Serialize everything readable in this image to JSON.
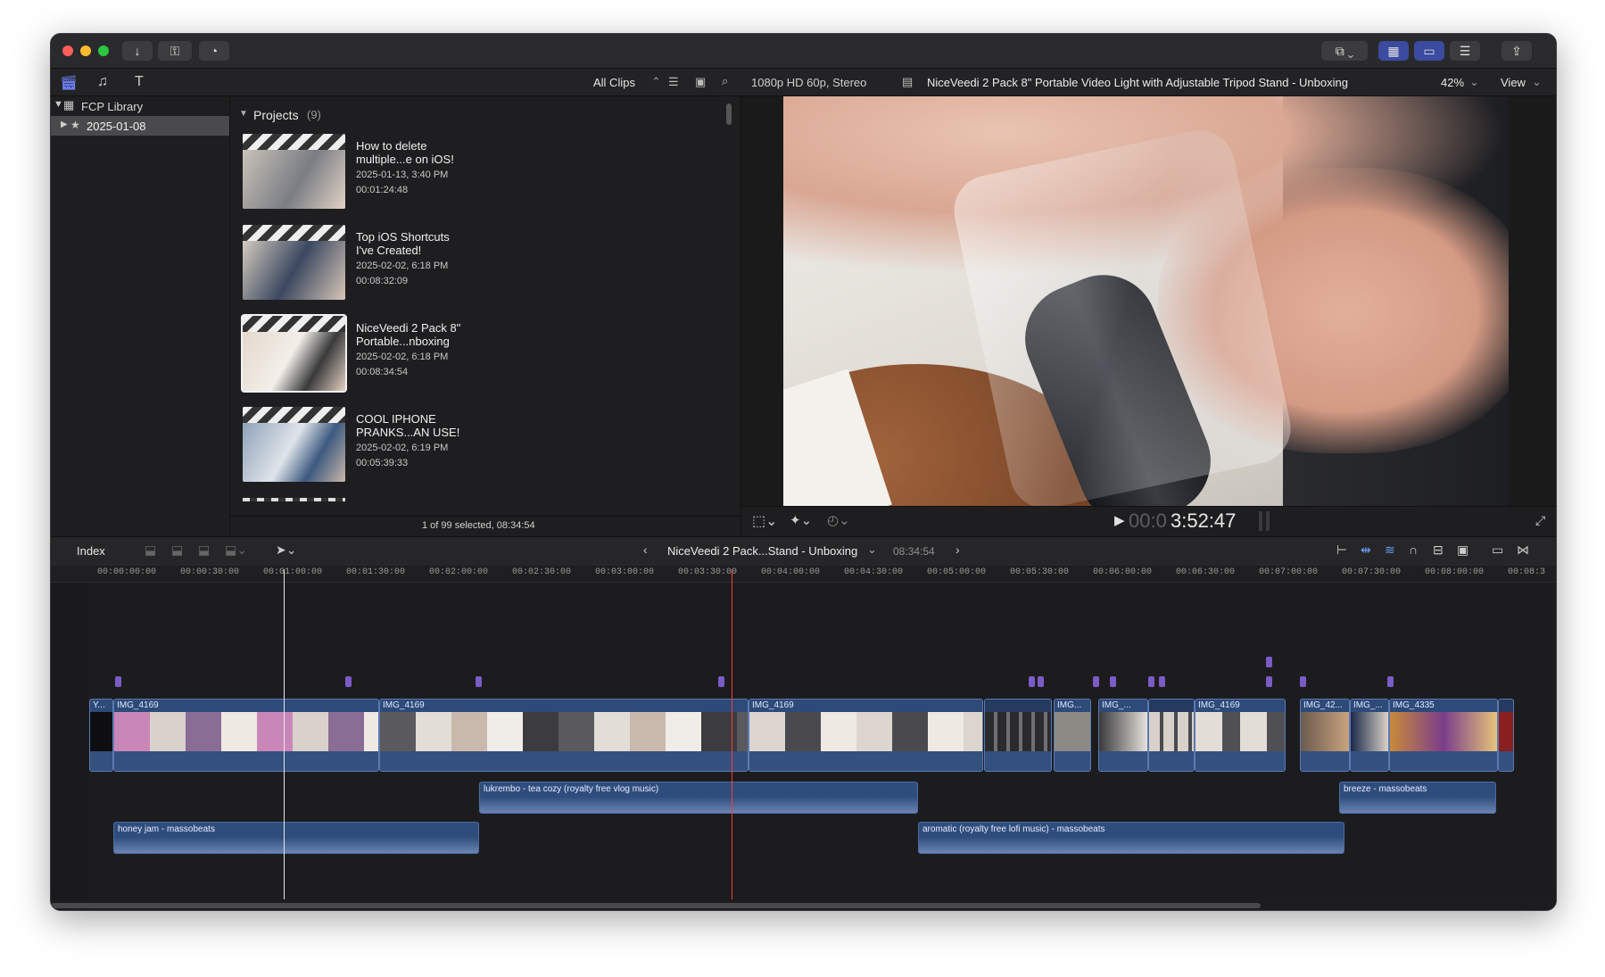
{
  "toolbar": {
    "import_icon": "download-icon",
    "keywords_icon": "key-icon",
    "bg_tasks_icon": "progress-icon"
  },
  "browser_header": {
    "filter": "All Clips"
  },
  "library": {
    "name": "FCP Library",
    "event": "2025-01-08"
  },
  "projects": {
    "header": "Projects",
    "count": "(9)",
    "items": [
      {
        "title": "How to delete\nmultiple...e on iOS!",
        "date": "2025-01-13, 3:40 PM",
        "duration": "00:01:24:48"
      },
      {
        "title": "Top iOS Shortcuts\nI've Created!",
        "date": "2025-02-02, 6:18 PM",
        "duration": "00:08:32:09"
      },
      {
        "title": "NiceVeedi 2 Pack 8\"\nPortable...nboxing",
        "date": "2025-02-02, 6:18 PM",
        "duration": "00:08:34:54"
      },
      {
        "title": "COOL IPHONE\nPRANKS...AN USE!",
        "date": "2025-02-02, 6:19 PM",
        "duration": "00:05:39:33"
      }
    ],
    "status": "1 of 99 selected, 08:34:54"
  },
  "viewer": {
    "format": "1080p HD 60p, Stereo",
    "title": "NiceVeedi 2 Pack 8\" Portable Video Light with Adjustable Tripod Stand - Unboxing",
    "zoom": "42%",
    "view": "View",
    "timecode_dim": "00:0",
    "timecode": "3:52:47"
  },
  "timeline_bar": {
    "index": "Index",
    "project": "NiceVeedi 2 Pack...Stand - Unboxing",
    "duration": "08:34:54"
  },
  "ruler": [
    "00:00:00:00",
    "00:00:30:00",
    "00:01:00:00",
    "00:01:30:00",
    "00:02:00:00",
    "00:02:30:00",
    "00:03:00:00",
    "00:03:30:00",
    "00:04:00:00",
    "00:04:30:00",
    "00:05:00:00",
    "00:05:30:00",
    "00:06:00:00",
    "00:06:30:00",
    "00:07:00:00",
    "00:07:30:00",
    "00:08:00:00",
    "00:08:3"
  ],
  "clips": {
    "c0": "Y...",
    "c1": "IMG_4169",
    "c2": "IMG_4169",
    "c3": "IMG_4169",
    "c4": "IMG...",
    "c5": "IMG_...",
    "c6": "IMG_4169",
    "c7": "IMG_42...",
    "c8": "IMG_...",
    "c9": "IMG_4335"
  },
  "audio": {
    "a1": "lukrembo - tea cozy (royalty free vlog music)",
    "a2": "breeze - massobeats",
    "a3": "honey jam - massobeats",
    "a4": "aromatic (royalty free lofi music) - massobeats"
  },
  "colors": {
    "accent": "#3a4ba0",
    "playhead": "#ff3b30",
    "clip": "#2d4a78",
    "marker": "#7b5cc7"
  }
}
